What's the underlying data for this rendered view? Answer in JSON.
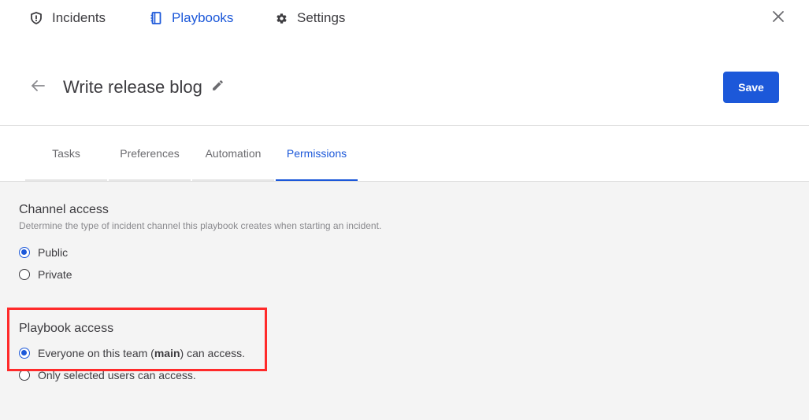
{
  "nav": {
    "items": [
      {
        "label": "Incidents",
        "icon": "shield-icon",
        "active": false
      },
      {
        "label": "Playbooks",
        "icon": "notebook-icon",
        "active": true
      },
      {
        "label": "Settings",
        "icon": "gear-icon",
        "active": false
      }
    ],
    "close_icon": "close-icon"
  },
  "header": {
    "title": "Write release blog",
    "back_icon": "arrow-left-icon",
    "edit_icon": "pencil-icon",
    "save_label": "Save"
  },
  "tabs": [
    {
      "label": "Tasks",
      "active": false
    },
    {
      "label": "Preferences",
      "active": false
    },
    {
      "label": "Automation",
      "active": false
    },
    {
      "label": "Permissions",
      "active": true
    }
  ],
  "channel_access": {
    "title": "Channel access",
    "description": "Determine the type of incident channel this playbook creates when starting an incident.",
    "options": [
      {
        "label": "Public",
        "checked": true
      },
      {
        "label": "Private",
        "checked": false
      }
    ]
  },
  "playbook_access": {
    "title": "Playbook access",
    "everyone_prefix": "Everyone on this team (",
    "team_name": "main",
    "everyone_suffix": ") can access.",
    "selected_label": "Only selected users can access.",
    "selected_option": "everyone"
  },
  "colors": {
    "accent": "#1c58d9",
    "highlight": "#ff2a2a",
    "content_bg": "#f4f4f4"
  }
}
